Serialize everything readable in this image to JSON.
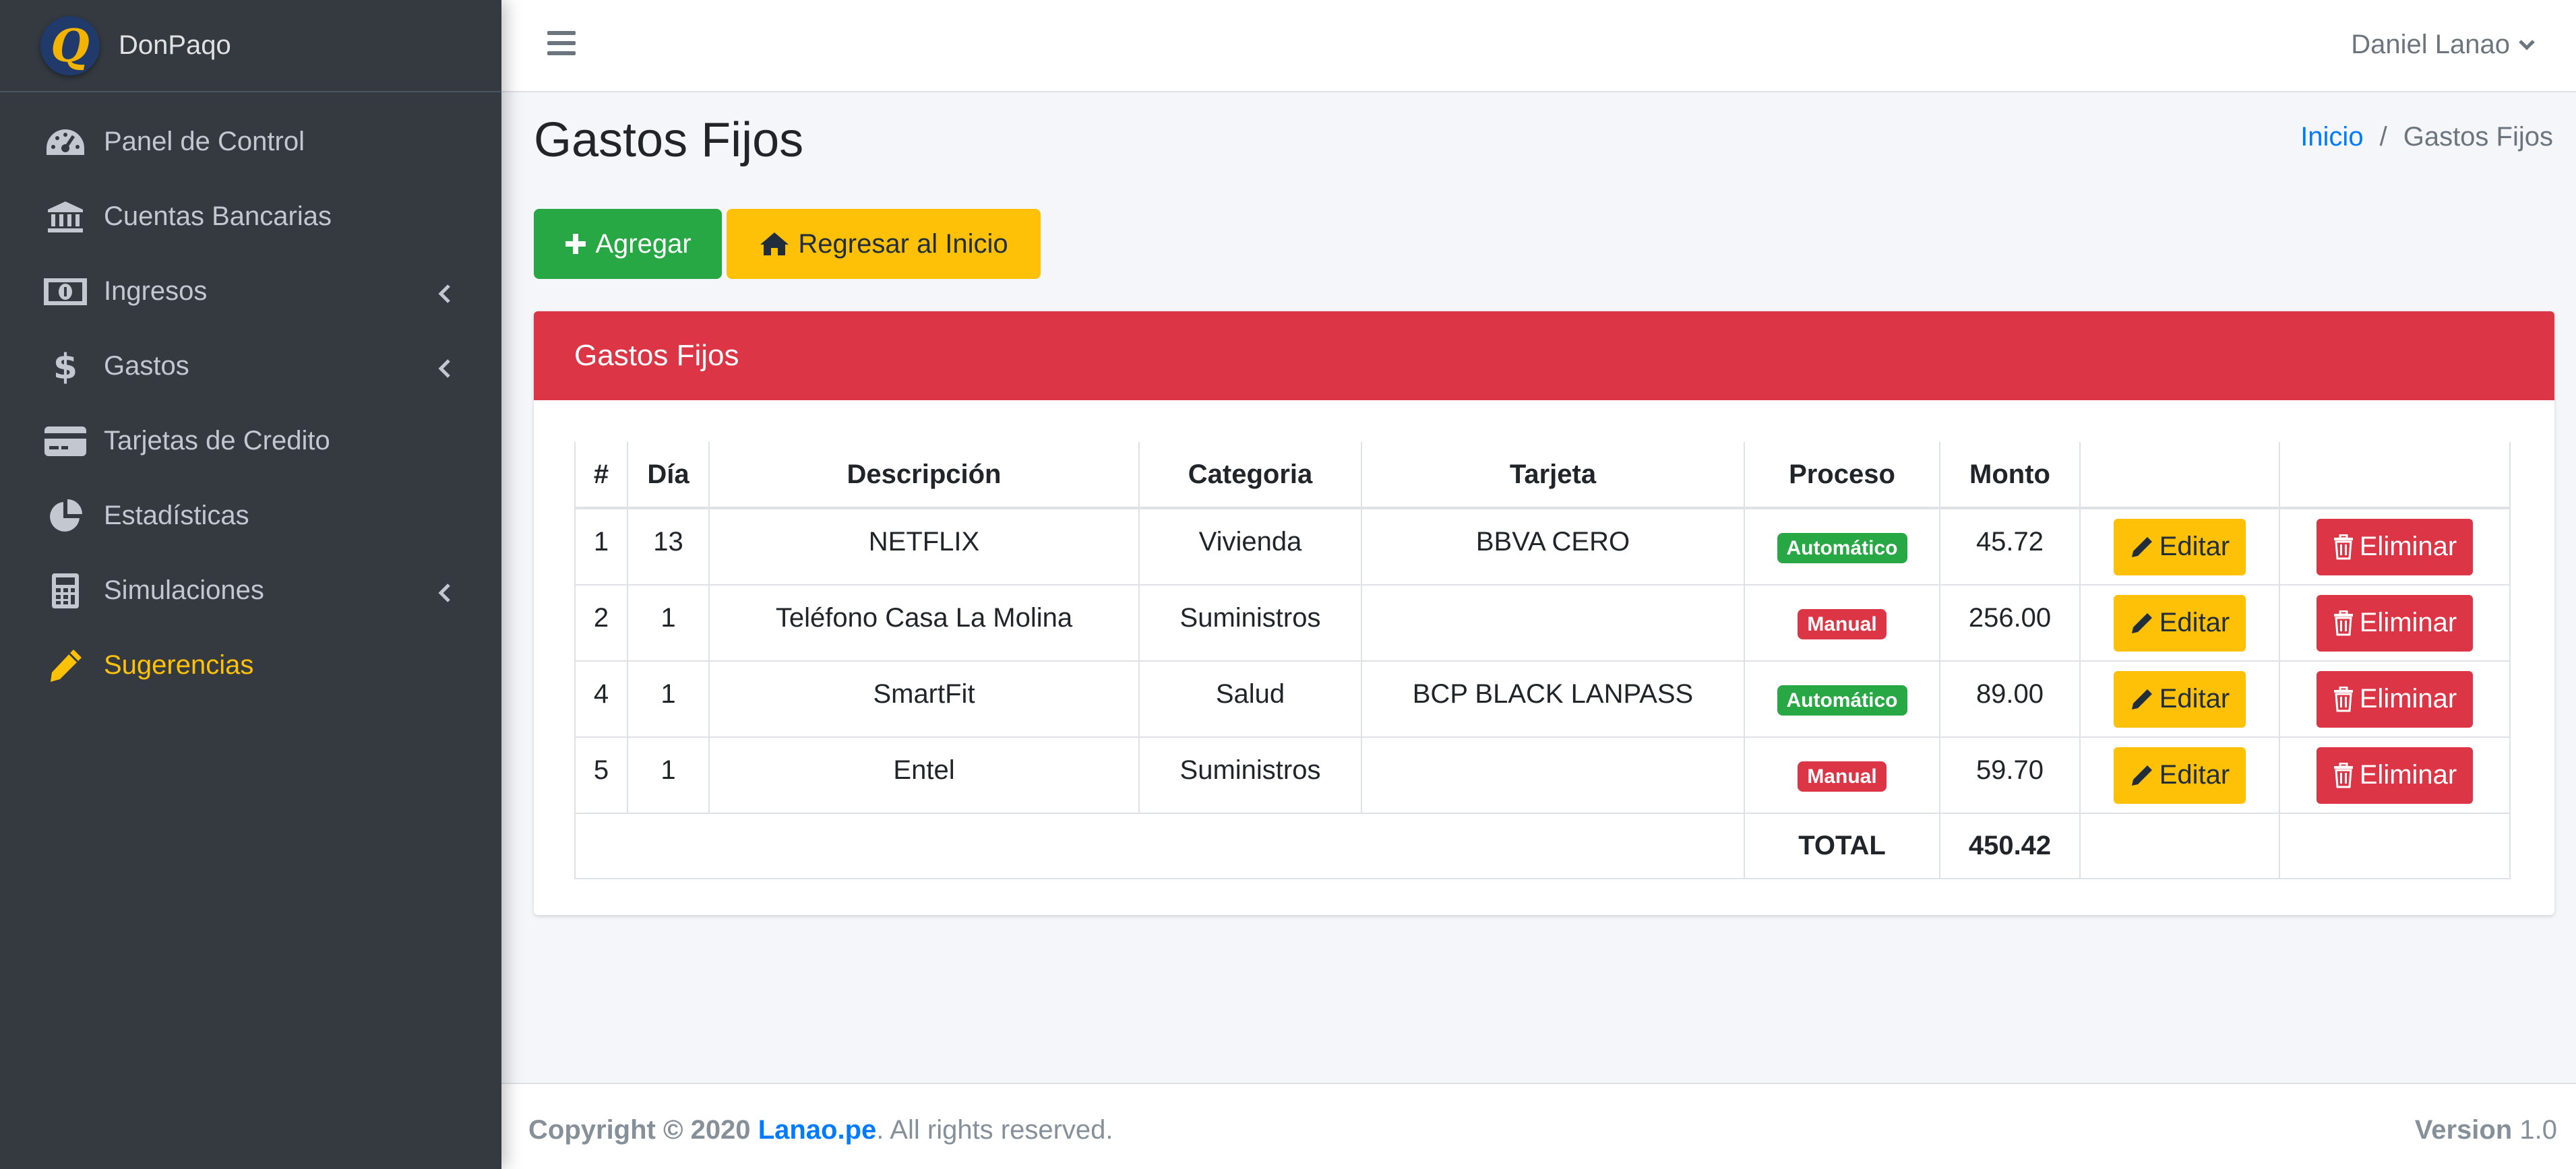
{
  "brand": {
    "name": "DonPaqo",
    "logo_letter": "Q"
  },
  "sidebar": {
    "items": [
      {
        "label": "Panel de Control",
        "icon": "tachometer-icon"
      },
      {
        "label": "Cuentas Bancarias",
        "icon": "bank-icon"
      },
      {
        "label": "Ingresos",
        "icon": "money-bill-icon",
        "has_submenu": true
      },
      {
        "label": "Gastos",
        "icon": "dollar-icon",
        "has_submenu": true
      },
      {
        "label": "Tarjetas de Credito",
        "icon": "credit-card-icon"
      },
      {
        "label": "Estadísticas",
        "icon": "pie-chart-icon"
      },
      {
        "label": "Simulaciones",
        "icon": "calculator-icon",
        "has_submenu": true
      },
      {
        "label": "Sugerencias",
        "icon": "pencil-icon",
        "active": true
      }
    ]
  },
  "header": {
    "user_name": "Daniel Lanao"
  },
  "page": {
    "title": "Gastos Fijos",
    "breadcrumb": {
      "home": "Inicio",
      "separator": "/",
      "current": "Gastos Fijos"
    },
    "buttons": {
      "add": "Agregar",
      "home": "Regresar al Inicio"
    }
  },
  "card": {
    "title": "Gastos Fijos"
  },
  "table": {
    "headers": [
      "#",
      "Día",
      "Descripción",
      "Categoria",
      "Tarjeta",
      "Proceso",
      "Monto",
      "",
      ""
    ],
    "rows": [
      {
        "id": "1",
        "dia": "13",
        "descripcion": "NETFLIX",
        "categoria": "Vivienda",
        "tarjeta": "BBVA CERO",
        "proceso": "Automático",
        "monto": "45.72"
      },
      {
        "id": "2",
        "dia": "1",
        "descripcion": "Teléfono Casa La Molina",
        "categoria": "Suministros",
        "tarjeta": "",
        "proceso": "Manual",
        "monto": "256.00"
      },
      {
        "id": "4",
        "dia": "1",
        "descripcion": "SmartFit",
        "categoria": "Salud",
        "tarjeta": "BCP BLACK LANPASS",
        "proceso": "Automático",
        "monto": "89.00"
      },
      {
        "id": "5",
        "dia": "1",
        "descripcion": "Entel",
        "categoria": "Suministros",
        "tarjeta": "",
        "proceso": "Manual",
        "monto": "59.70"
      }
    ],
    "edit_label": "Editar",
    "delete_label": "Eliminar",
    "total_label": "TOTAL",
    "total_value": "450.42"
  },
  "footer": {
    "copyright": "Copyright © 2020",
    "link": "Lanao.pe",
    "rights": ". All rights reserved.",
    "version_label": "Version",
    "version_value": "1.0"
  },
  "colors": {
    "success": "#28a745",
    "warning": "#ffc107",
    "danger": "#dc3545",
    "primary": "#007bff",
    "sidebar": "#343a40"
  }
}
